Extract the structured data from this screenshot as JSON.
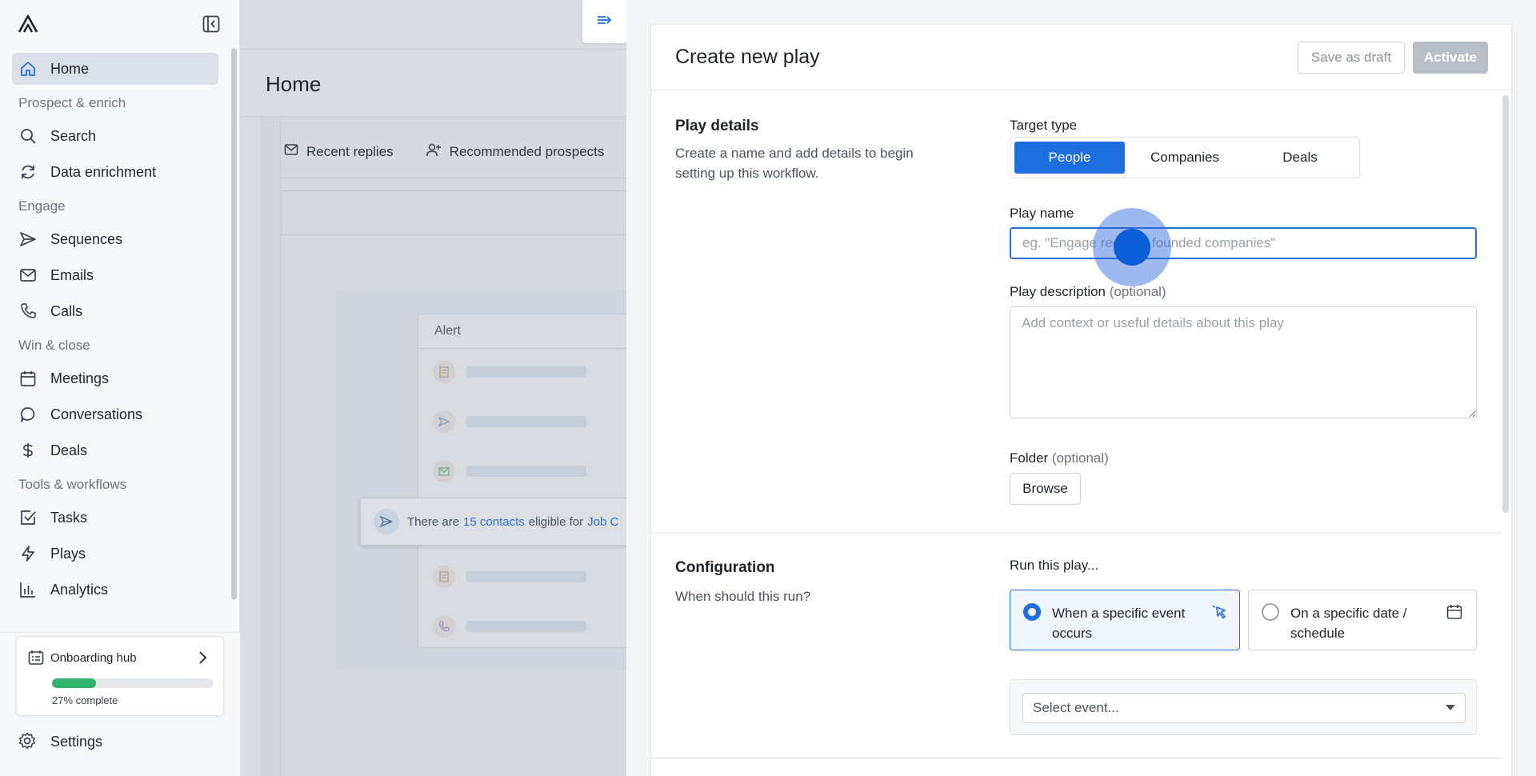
{
  "sidebar": {
    "items": [
      {
        "label": "Home",
        "icon": "home-icon"
      },
      {
        "section": "Prospect & enrich"
      },
      {
        "label": "Search",
        "icon": "search-icon"
      },
      {
        "label": "Data enrichment",
        "icon": "refresh-icon"
      },
      {
        "section": "Engage"
      },
      {
        "label": "Sequences",
        "icon": "send-icon"
      },
      {
        "label": "Emails",
        "icon": "mail-icon"
      },
      {
        "label": "Calls",
        "icon": "phone-icon"
      },
      {
        "section": "Win & close"
      },
      {
        "label": "Meetings",
        "icon": "calendar-icon"
      },
      {
        "label": "Conversations",
        "icon": "chat-bubble-icon"
      },
      {
        "label": "Deals",
        "icon": "dollar-icon"
      },
      {
        "section": "Tools & workflows"
      },
      {
        "label": "Tasks",
        "icon": "checkbox-icon"
      },
      {
        "label": "Plays",
        "icon": "lightning-icon"
      },
      {
        "label": "Analytics",
        "icon": "bar-chart-icon"
      }
    ],
    "onboarding": {
      "title": "Onboarding hub",
      "progress_label": "27% complete",
      "progress": 27
    },
    "settings_label": "Settings"
  },
  "main": {
    "title": "Home",
    "tabs": [
      "Recent replies",
      "Recommended prospects"
    ],
    "alert_title": "Alert",
    "toast": {
      "prefix": "There are",
      "link": "15 contacts",
      "middle": "eligible for",
      "link2": "Job C"
    }
  },
  "panel": {
    "title": "Create new play",
    "save_draft": "Save as draft",
    "activate": "Activate",
    "details": {
      "title": "Play details",
      "desc": "Create a name and add details to begin setting up this workflow.",
      "target_label": "Target type",
      "target_options": [
        "People",
        "Companies",
        "Deals"
      ],
      "name_label": "Play name",
      "name_placeholder": "eg. \"Engage recently founded companies\"",
      "desc_label": "Play description",
      "optional": "(optional)",
      "desc_placeholder": "Add context or useful details about this play",
      "folder_label": "Folder",
      "browse": "Browse"
    },
    "config": {
      "title": "Configuration",
      "desc": "When should this run?",
      "run_label": "Run this play...",
      "option_event": "When a specific event occurs",
      "option_date": "On a specific date / schedule",
      "select_placeholder": "Select event..."
    }
  },
  "colors": {
    "accent": "#1d6fe0",
    "progress": "#2fb36a"
  }
}
